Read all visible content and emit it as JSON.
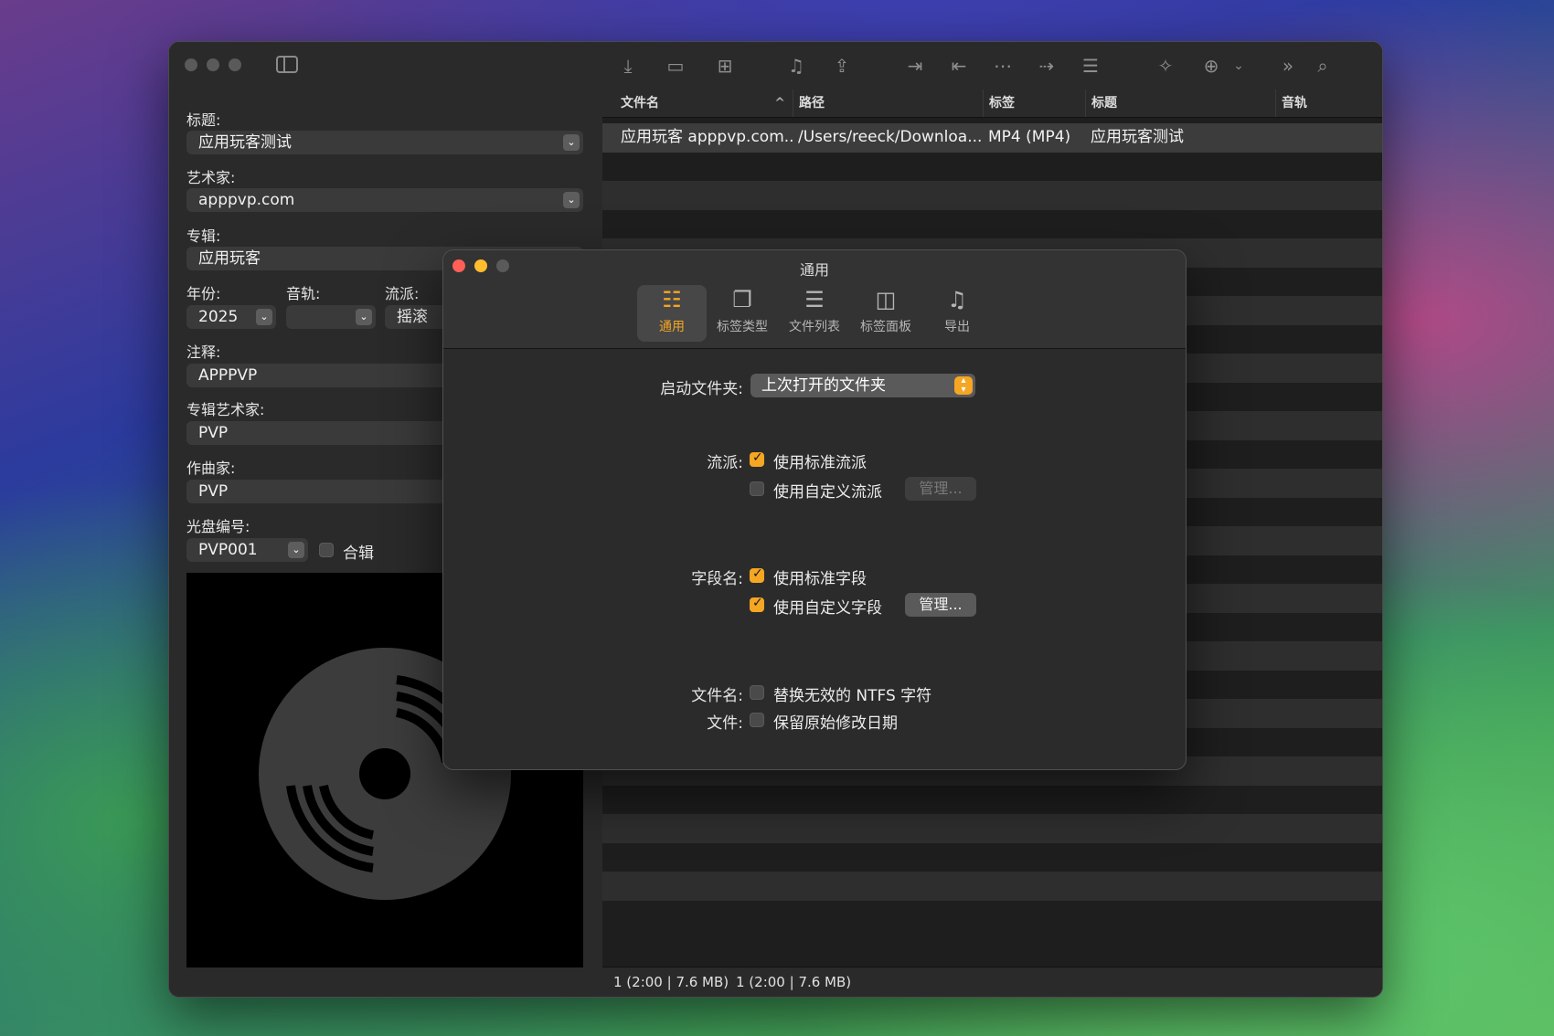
{
  "left_panel": {
    "fields": {
      "title": {
        "label": "标题:",
        "value": "应用玩客测试"
      },
      "artist": {
        "label": "艺术家:",
        "value": "apppvp.com"
      },
      "album": {
        "label": "专辑:",
        "value": "应用玩客"
      },
      "year": {
        "label": "年份:",
        "value": "2025"
      },
      "track": {
        "label": "音轨:",
        "value": ""
      },
      "genre": {
        "label": "流派:",
        "value": "摇滚"
      },
      "comment": {
        "label": "注释:",
        "value": "APPPVP"
      },
      "album_artist": {
        "label": "专辑艺术家:",
        "value": "PVP"
      },
      "composer": {
        "label": "作曲家:",
        "value": "PVP"
      },
      "disc": {
        "label": "光盘编号:",
        "value": "PVP001"
      }
    },
    "compilation_label": "合辑",
    "compilation_checked": false
  },
  "toolbar": {
    "icons": [
      "import-icon",
      "folder-icon",
      "folder-add-icon",
      "music-list-icon",
      "share-icon",
      "tag-to-file-icon",
      "file-to-tag-icon",
      "tag-to-tag-icon",
      "file-action-icon",
      "list-icon",
      "magic-wand-icon",
      "add-to-list-icon",
      "chevron-down-icon",
      "more-icon",
      "search-icon"
    ]
  },
  "file_list": {
    "columns": [
      "文件名",
      "路径",
      "标签",
      "标题",
      "音轨"
    ],
    "sort_indicator": "^",
    "rows": [
      {
        "filename": "应用玩客 apppvp.com....",
        "path": "/Users/reeck/Downloa...",
        "tag": "MP4 (MP4)",
        "title": "应用玩客测试",
        "track": ""
      }
    ],
    "status_left": "1 (2:00 | 7.6 MB)",
    "status_right": "1 (2:00 | 7.6 MB)"
  },
  "dialog": {
    "title": "通用",
    "tabs": [
      {
        "label": "通用",
        "icon": "general-icon",
        "active": true
      },
      {
        "label": "标签类型",
        "icon": "tag-types-icon",
        "active": false
      },
      {
        "label": "文件列表",
        "icon": "file-list-icon",
        "active": false
      },
      {
        "label": "标签面板",
        "icon": "tag-panel-icon",
        "active": false
      },
      {
        "label": "导出",
        "icon": "export-icon",
        "active": false
      }
    ],
    "startup_folder": {
      "label": "启动文件夹:",
      "value": "上次打开的文件夹"
    },
    "genre": {
      "label": "流派:",
      "standard": {
        "text": "使用标准流派",
        "checked": true
      },
      "custom": {
        "text": "使用自定义流派",
        "checked": false
      },
      "manage": "管理..."
    },
    "fields": {
      "label": "字段名:",
      "standard": {
        "text": "使用标准字段",
        "checked": true
      },
      "custom": {
        "text": "使用自定义字段",
        "checked": true
      },
      "manage": "管理..."
    },
    "filename": {
      "label": "文件名:",
      "text": "替换无效的 NTFS 字符",
      "checked": false
    },
    "file": {
      "label": "文件:",
      "text": "保留原始修改日期",
      "checked": false
    }
  },
  "colors": {
    "accent": "#f5a623",
    "close": "#ff5f57",
    "minimize": "#febc2e",
    "inactive": "#5a5a5a"
  }
}
